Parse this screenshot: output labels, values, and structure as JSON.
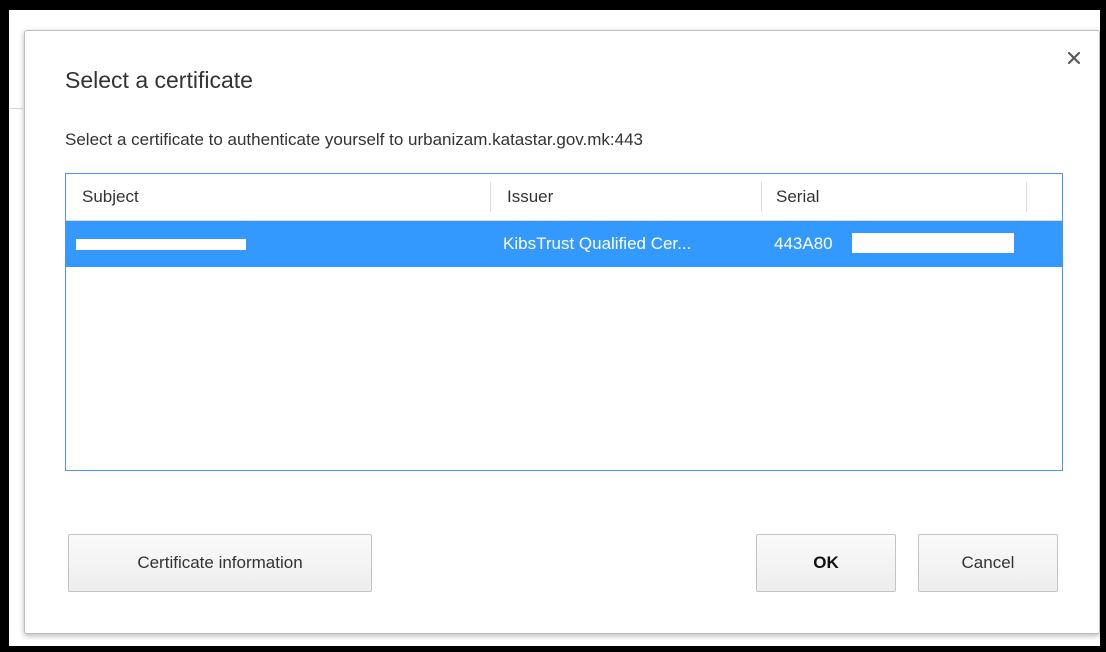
{
  "dialog": {
    "title": "Select a certificate",
    "subtitle": "Select a certificate to authenticate yourself to urbanizam.katastar.gov.mk:443",
    "close_icon": "close-icon",
    "close_glyph": "×"
  },
  "table": {
    "columns": [
      "Subject",
      "Issuer",
      "Serial"
    ],
    "rows": [
      {
        "subject": "",
        "issuer": "KibsTrust Qualified Cer...",
        "serial": "443A80",
        "selected": true
      }
    ]
  },
  "buttons": {
    "certificate_info": "Certificate information",
    "ok": "OK",
    "cancel": "Cancel"
  },
  "colors": {
    "selection": "#3399ff",
    "table_border": "#4d90fe"
  }
}
